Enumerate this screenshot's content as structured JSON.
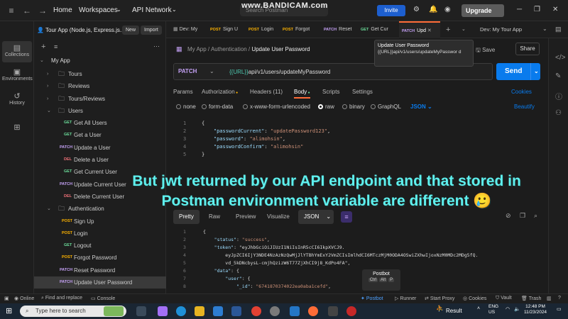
{
  "titlebar": {
    "home": "Home",
    "workspaces": "Workspaces",
    "api_network": "API Network",
    "search_placeholder": "Search Postman",
    "watermark": "www.BANDICAM.com",
    "invite": "Invite",
    "upgrade": "Upgrade"
  },
  "left_rail": {
    "items": [
      "Collections",
      "Environments",
      "History"
    ]
  },
  "sidebar": {
    "workspace_name": "Tour App (Node.js, Express.js...",
    "new_label": "New",
    "import_label": "Import",
    "collection_name": "My App",
    "tree": [
      {
        "type": "folder",
        "label": "Tours",
        "level": 1,
        "expanded": false
      },
      {
        "type": "folder",
        "label": "Reviews",
        "level": 1,
        "expanded": false
      },
      {
        "type": "folder",
        "label": "Tours/Reviews",
        "level": 1,
        "expanded": false
      },
      {
        "type": "folder",
        "label": "Users",
        "level": 1,
        "expanded": true
      },
      {
        "type": "request",
        "method": "GET",
        "label": "Get All Users"
      },
      {
        "type": "request",
        "method": "GET",
        "label": "Get a User"
      },
      {
        "type": "request",
        "method": "PATCH",
        "label": "Update a User"
      },
      {
        "type": "request",
        "method": "DEL",
        "label": "Delete a User"
      },
      {
        "type": "request",
        "method": "GET",
        "label": "Get Current User"
      },
      {
        "type": "request",
        "method": "PATCH",
        "label": "Update Current User"
      },
      {
        "type": "request",
        "method": "DEL",
        "label": "Delete Current User"
      },
      {
        "type": "folder",
        "label": "Authentication",
        "level": 1,
        "expanded": true
      },
      {
        "type": "request",
        "method": "POST",
        "label": "Sign Up"
      },
      {
        "type": "request",
        "method": "POST",
        "label": "Login"
      },
      {
        "type": "request",
        "method": "GET",
        "label": "Logout"
      },
      {
        "type": "request",
        "method": "POST",
        "label": "Forgot Password"
      },
      {
        "type": "request",
        "method": "PATCH",
        "label": "Reset Password"
      },
      {
        "type": "request",
        "method": "PATCH",
        "label": "Update User Password",
        "selected": true
      }
    ]
  },
  "tabs": [
    {
      "method": "",
      "label": "Dev: My"
    },
    {
      "method": "POST",
      "label": "Sign U"
    },
    {
      "method": "POST",
      "label": "Login"
    },
    {
      "method": "POST",
      "label": "Forgot"
    },
    {
      "method": "PATCH",
      "label": "Reset"
    },
    {
      "method": "GET",
      "label": "Get Cur"
    },
    {
      "method": "PATCH",
      "label": "Upd",
      "active": true
    }
  ],
  "environment": "Dev: My Tour App",
  "tooltip": {
    "title": "Update User Password",
    "text": "{{URL}}api/v1/users/updateMyPasswor d"
  },
  "request": {
    "breadcrumb_collection": "My App",
    "breadcrumb_folder": "Authentication",
    "breadcrumb_current": "Update User Password",
    "save": "Save",
    "share": "Share",
    "method": "PATCH",
    "url_var": "{{URL}}",
    "url_path": "api/v1/users/updateMyPassword",
    "send": "Send",
    "tabs": [
      "Params",
      "Authorization",
      "Headers (11)",
      "Body",
      "Scripts",
      "Settings"
    ],
    "cookies": "Cookies",
    "body_types": [
      "none",
      "form-data",
      "x-www-form-urlencoded",
      "raw",
      "binary",
      "GraphQL"
    ],
    "json_select": "JSON",
    "beautify": "Beautify",
    "body_lines": [
      "{",
      "    \"passwordCurrent\": \"updatePassword123\",",
      "    \"password\": \"alimohsin\",",
      "    \"passwordConfirm\": \"alimohsin\"",
      "}"
    ]
  },
  "overlay_caption": "But jwt returned by our API endpoint and that stored in Postman environment variable are different 🥲",
  "response": {
    "tabs": [
      "Pretty",
      "Raw",
      "Preview",
      "Visualize"
    ],
    "format": "JSON",
    "lines": [
      "{",
      "    \"status\": \"success\",",
      "    \"token\": \"eyJhbGciOiJIUzI1NiIsInR5cCI6IkpXVCJ9.",
      "        eyJpZCI6IjY3NDE4NzAzNzQwMjJlYTBhYmExY2VmZCIsImlhdCI6MTczMjM0ODA4OSwiZXhwIjoxNzM0MDc2MDg5fQ.",
      "        vd_5kDNcbysL-cmjhQzizW6T77ZjXhCI9j8_KdPo4FA\",",
      "    \"data\": {",
      "        \"user\": {",
      "            \"_id\": \"6741870374022ea0aba1cefd\","
    ]
  },
  "postbot_tip": {
    "label": "Postbot",
    "keys": [
      "Ctrl",
      "Alt",
      "P"
    ]
  },
  "statusbar": {
    "online": "Online",
    "find": "Find and replace",
    "console": "Console",
    "postbot": "Postbot",
    "runner": "Runner",
    "start_proxy": "Start Proxy",
    "cookies": "Cookies",
    "vault": "Vault",
    "trash": "Trash"
  },
  "taskbar": {
    "search_placeholder": "Type here to search",
    "result": "Result",
    "lang": "ENG",
    "region": "US",
    "time": "12:48 PM",
    "date": "11/23/2024"
  }
}
